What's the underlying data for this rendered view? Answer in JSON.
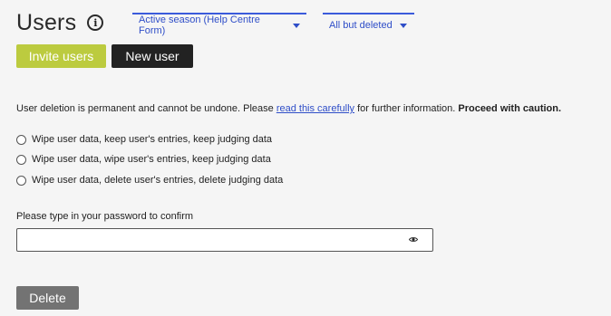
{
  "header": {
    "title": "Users",
    "info_icon": "info-icon"
  },
  "filters": {
    "season": "Active season (Help Centre Form)",
    "status": "All but deleted"
  },
  "actions": {
    "invite_label": "Invite users",
    "new_user_label": "New user"
  },
  "warning": {
    "text_before": "User deletion is permanent and cannot be undone. Please ",
    "link_text": "read this carefully",
    "text_after": " for further information. ",
    "emphasis": "Proceed with caution."
  },
  "options": [
    {
      "label": "Wipe user data, keep user's entries, keep judging data"
    },
    {
      "label": "Wipe user data, wipe user's entries, keep judging data"
    },
    {
      "label": "Wipe user data, delete user's entries, delete judging data"
    }
  ],
  "password": {
    "label": "Please type in your password to confirm",
    "value": "",
    "toggle_icon": "eye-icon"
  },
  "delete_label": "Delete",
  "colors": {
    "accent_link": "#2f4ec8",
    "invite_button": "#bccb3f",
    "new_user_button": "#222222",
    "delete_button": "#737373",
    "background": "#f5f5f5"
  }
}
